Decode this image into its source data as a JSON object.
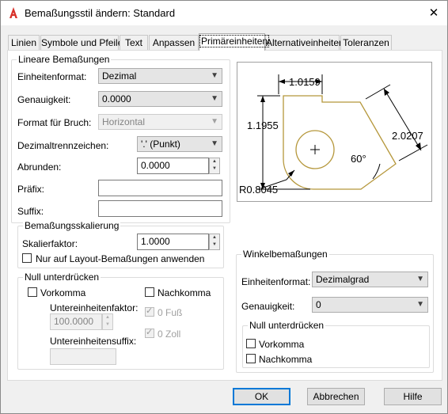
{
  "dialog": {
    "title": "Bemaßungsstil ändern: Standard"
  },
  "tabs": [
    "Linien",
    "Symbole und Pfeile",
    "Text",
    "Anpassen",
    "Primäreinheiten",
    "Alternativeinheiten",
    "Toleranzen"
  ],
  "linear": {
    "group_title": "Lineare Bemaßungen",
    "unit_format_label": "Einheitenformat:",
    "unit_format_value": "Dezimal",
    "precision_label": "Genauigkeit:",
    "precision_value": "0.0000",
    "fraction_label": "Format für Bruch:",
    "fraction_value": "Horizontal",
    "decimal_sep_label": "Dezimaltrennzeichen:",
    "decimal_sep_value": "'.' (Punkt)",
    "round_label": "Abrunden:",
    "round_value": "0.0000",
    "prefix_label": "Präfix:",
    "prefix_value": "",
    "suffix_label": "Suffix:",
    "suffix_value": ""
  },
  "scale": {
    "group_title": "Bemaßungsskalierung",
    "factor_label": "Skalierfaktor:",
    "factor_value": "1.0000",
    "layout_only_label": "Nur auf Layout-Bemaßungen anwenden"
  },
  "zero_linear": {
    "group_title": "Null unterdrücken",
    "leading_label": "Vorkomma",
    "trailing_label": "Nachkomma",
    "subunit_factor_label": "Untereinheitenfaktor:",
    "subunit_factor_value": "100.0000",
    "subunit_suffix_label": "Untereinheitensuffix:",
    "subunit_suffix_value": "",
    "zero_feet_label": "0 Fuß",
    "zero_inches_label": "0 Zoll"
  },
  "preview": {
    "dim_top": "1.0159",
    "dim_left": "1.1955",
    "dim_diag": "2.0207",
    "angle": "60°",
    "radius": "R0.8045",
    "line_color": "#b5973b"
  },
  "angular": {
    "group_title": "Winkelbemaßungen",
    "unit_format_label": "Einheitenformat:",
    "unit_format_value": "Dezimalgrad",
    "precision_label": "Genauigkeit:",
    "precision_value": "0",
    "zero_group_title": "Null unterdrücken",
    "leading_label": "Vorkomma",
    "trailing_label": "Nachkomma"
  },
  "buttons": {
    "ok": "OK",
    "cancel": "Abbrechen",
    "help": "Hilfe"
  },
  "colors": {
    "accent": "#0078d7",
    "icon_red": "#d8312a"
  }
}
